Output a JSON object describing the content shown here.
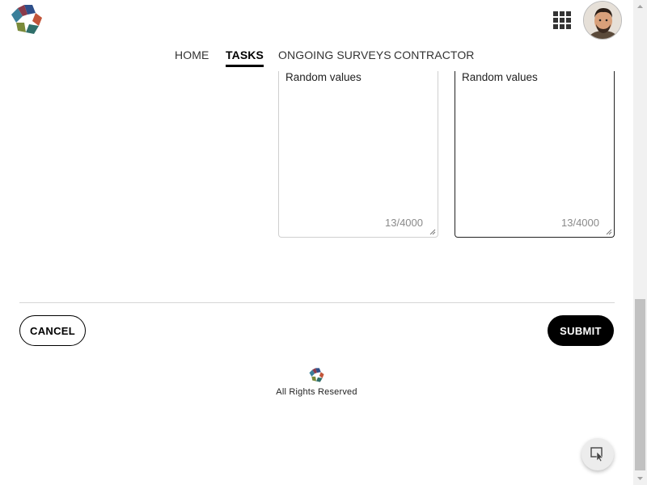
{
  "header": {
    "logo_icon": "flower-logo",
    "apps_icon": "grid-icon",
    "avatar": "user-avatar"
  },
  "nav": {
    "items": [
      {
        "label": "HOME",
        "active": false
      },
      {
        "label": "TASKS",
        "active": true
      },
      {
        "label": "ONGOING SURVEYS",
        "active": false
      },
      {
        "label": "CONTRACTOR",
        "active": false
      }
    ]
  },
  "form": {
    "fields": [
      {
        "value": "Random values",
        "counter": "13/4000",
        "focused": false
      },
      {
        "value": "Random values",
        "counter": "13/4000",
        "focused": true
      }
    ],
    "cancel_label": "CANCEL",
    "submit_label": "SUBMIT"
  },
  "footer": {
    "text": "All Rights Reserved"
  },
  "fab": {
    "icon": "cursor-select-icon"
  },
  "colors": {
    "primary": "#000000",
    "border": "#cfcfcf",
    "muted": "#8a8a8a",
    "logo_red": "#c2553a",
    "logo_teal": "#2f6f6a",
    "logo_blue": "#2e4f8a",
    "logo_olive": "#7a8a3a"
  }
}
